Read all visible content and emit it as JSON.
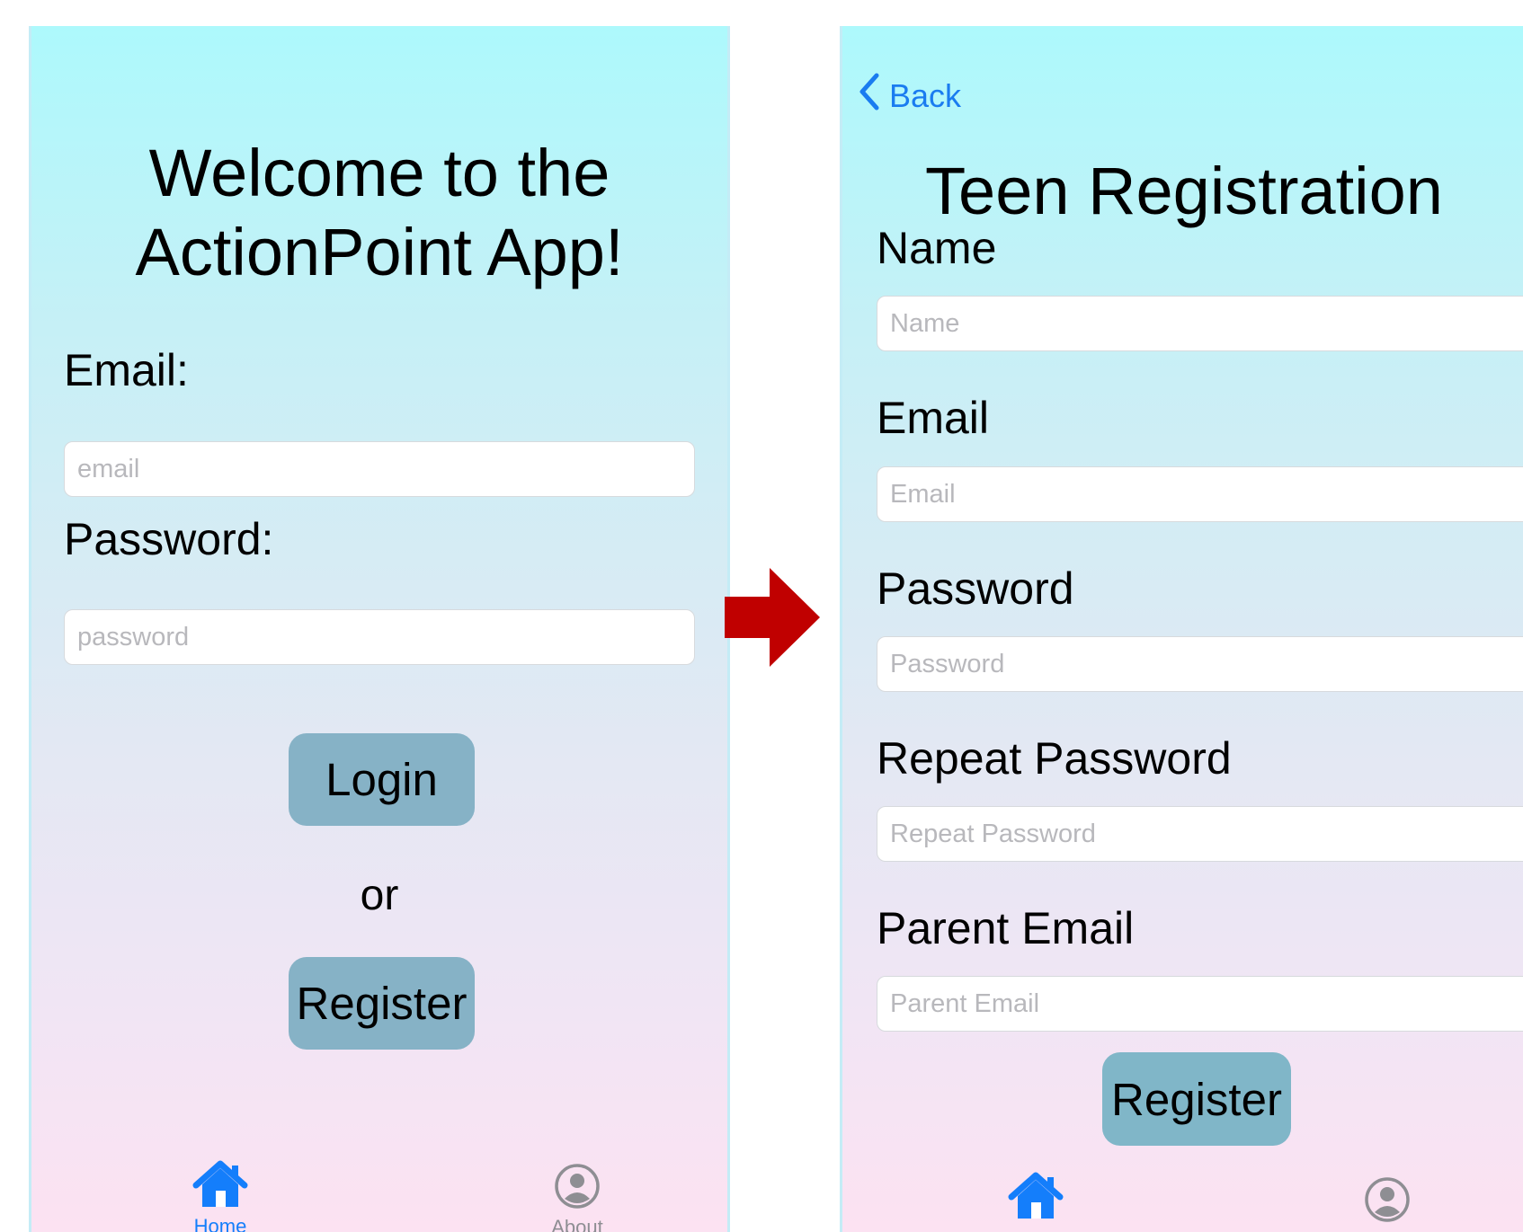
{
  "login_screen": {
    "title": "Welcome to the ActionPoint App!",
    "email_label": "Email:",
    "email_placeholder": "email",
    "password_label": "Password:",
    "password_placeholder": "password",
    "login_button": "Login",
    "or_text": "or",
    "register_button": "Register",
    "tabbar": {
      "home_label": "Home",
      "about_label": "About",
      "active_color": "#147efb",
      "inactive_color": "#8e8e93"
    }
  },
  "transition_arrow": {
    "color": "#c00000"
  },
  "registration_screen": {
    "back_label": "Back",
    "title": "Teen Registration",
    "fields": [
      {
        "label": "Name",
        "placeholder": "Name"
      },
      {
        "label": "Email",
        "placeholder": "Email"
      },
      {
        "label": "Password",
        "placeholder": "Password"
      },
      {
        "label": "Repeat Password",
        "placeholder": "Repeat Password"
      },
      {
        "label": "Parent Email",
        "placeholder": "Parent Email"
      }
    ],
    "register_button": "Register",
    "tabbar": {
      "home_icon": "house-icon",
      "about_icon": "person-circle-icon"
    }
  },
  "colors": {
    "button_bg": "#86b2c6",
    "link_blue": "#1a7cf0",
    "gradient_top": "#adf9fc",
    "gradient_bottom": "#fce2f2"
  }
}
